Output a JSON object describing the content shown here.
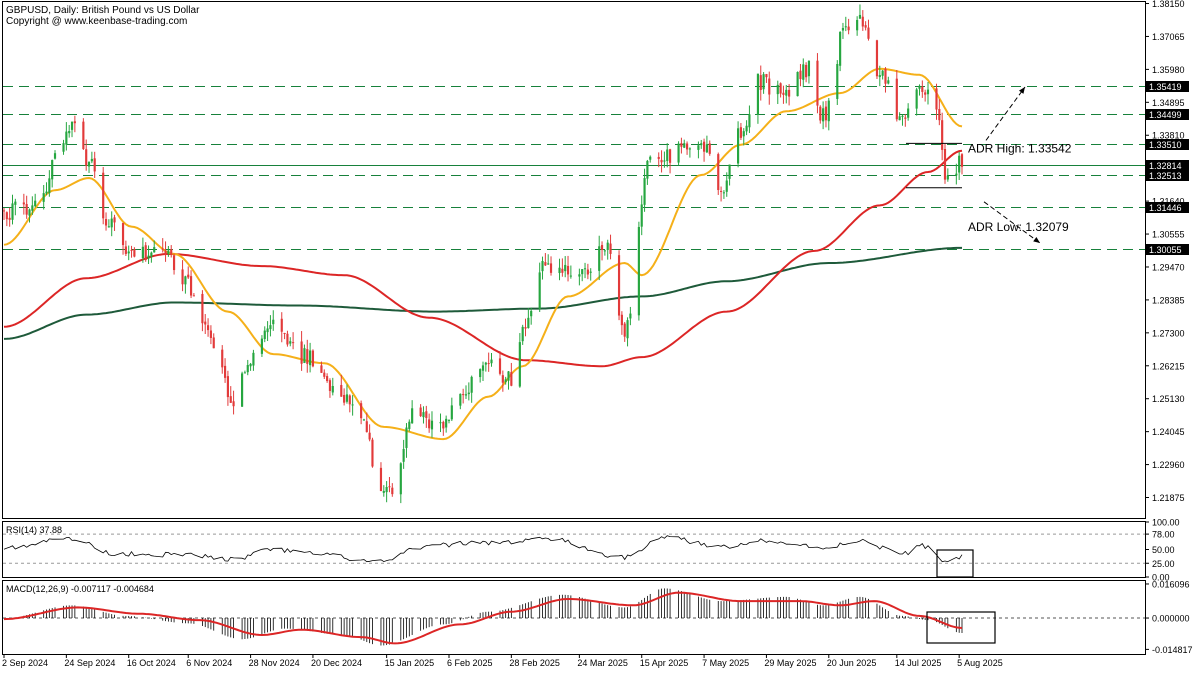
{
  "header": {
    "title": "GBPUSD, Daily:  British Pound vs US Dollar",
    "copyright": "Copyright @ www.keenbase-trading.com"
  },
  "colors": {
    "bull": "#26a640",
    "bear": "#e23a3a",
    "ma_fast": "#f5b019",
    "ma_mid": "#dc2626",
    "ma_slow": "#1e5a3a",
    "level_line": "#17813b",
    "annotation": "#000000"
  },
  "chart_data": [
    {
      "type": "candlestick",
      "panel": "main",
      "title": "GBPUSD, Daily:  British Pound vs US Dollar",
      "ylim": [
        1.212,
        1.382
      ],
      "y_ticks": [
        "1.38150",
        "1.37065",
        "1.35980",
        "1.34895",
        "1.33810",
        "1.31640",
        "1.30555",
        "1.29470",
        "1.28385",
        "1.27300",
        "1.26215",
        "1.25130",
        "1.24045",
        "1.22960",
        "1.21875"
      ],
      "x_ticks": [
        "2 Sep 2024",
        "24 Sep 2024",
        "16 Oct 2024",
        "6 Nov 2024",
        "28 Nov 2024",
        "20 Dec 2024",
        "15 Jan 2025",
        "6 Feb 2025",
        "28 Feb 2025",
        "24 Mar 2025",
        "15 Apr 2025",
        "7 May 2025",
        "29 May 2025",
        "20 Jun 2025",
        "14 Jul 2025",
        "5 Aug 2025"
      ],
      "close_anchors": [
        [
          "2024-09-02",
          1.313
        ],
        [
          "2024-09-12",
          1.314
        ],
        [
          "2024-09-26",
          1.34
        ],
        [
          "2024-10-02",
          1.329
        ],
        [
          "2024-10-08",
          1.309
        ],
        [
          "2024-10-17",
          1.3
        ],
        [
          "2024-10-30",
          1.298
        ],
        [
          "2024-11-06",
          1.289
        ],
        [
          "2024-11-12",
          1.276
        ],
        [
          "2024-11-22",
          1.251
        ],
        [
          "2024-11-28",
          1.264
        ],
        [
          "2024-12-06",
          1.276
        ],
        [
          "2024-12-18",
          1.265
        ],
        [
          "2024-12-31",
          1.252
        ],
        [
          "2025-01-06",
          1.246
        ],
        [
          "2025-01-13",
          1.219
        ],
        [
          "2025-01-17",
          1.22
        ],
        [
          "2025-01-24",
          1.248
        ],
        [
          "2025-02-03",
          1.242
        ],
        [
          "2025-02-14",
          1.256
        ],
        [
          "2025-02-20",
          1.262
        ],
        [
          "2025-02-28",
          1.258
        ],
        [
          "2025-03-04",
          1.275
        ],
        [
          "2025-03-12",
          1.295
        ],
        [
          "2025-03-26",
          1.293
        ],
        [
          "2025-04-02",
          1.302
        ],
        [
          "2025-04-09",
          1.274
        ],
        [
          "2025-04-18",
          1.329
        ],
        [
          "2025-04-25",
          1.332
        ],
        [
          "2025-05-06",
          1.336
        ],
        [
          "2025-05-13",
          1.321
        ],
        [
          "2025-05-20",
          1.339
        ],
        [
          "2025-05-26",
          1.356
        ],
        [
          "2025-06-04",
          1.352
        ],
        [
          "2025-06-13",
          1.36
        ],
        [
          "2025-06-18",
          1.344
        ],
        [
          "2025-06-26",
          1.374
        ],
        [
          "2025-07-01",
          1.376
        ],
        [
          "2025-07-08",
          1.359
        ],
        [
          "2025-07-16",
          1.343
        ],
        [
          "2025-07-23",
          1.355
        ],
        [
          "2025-07-28",
          1.344
        ],
        [
          "2025-08-01",
          1.323
        ],
        [
          "2025-08-05",
          1.329
        ]
      ],
      "levels": [
        "1.35419",
        "1.34499",
        "1.33510",
        "1.32513",
        "1.31446",
        "1.30055"
      ],
      "current_price": "1.32814",
      "annotations": {
        "adr_high": "ADR High: 1.33542",
        "adr_low": "ADR Low: 1.32079"
      },
      "ma_fast_anchors": [
        [
          "2024-09-02",
          1.302
        ],
        [
          "2024-09-20",
          1.32
        ],
        [
          "2024-10-02",
          1.324
        ],
        [
          "2024-10-17",
          1.308
        ],
        [
          "2024-11-01",
          1.299
        ],
        [
          "2024-11-20",
          1.28
        ],
        [
          "2024-12-06",
          1.266
        ],
        [
          "2024-12-24",
          1.263
        ],
        [
          "2025-01-14",
          1.242
        ],
        [
          "2025-02-04",
          1.238
        ],
        [
          "2025-02-20",
          1.252
        ],
        [
          "2025-03-04",
          1.262
        ],
        [
          "2025-03-20",
          1.285
        ],
        [
          "2025-04-09",
          1.296
        ],
        [
          "2025-04-15",
          1.292
        ],
        [
          "2025-05-06",
          1.325
        ],
        [
          "2025-05-20",
          1.335
        ],
        [
          "2025-06-05",
          1.346
        ],
        [
          "2025-06-24",
          1.352
        ],
        [
          "2025-07-08",
          1.36
        ],
        [
          "2025-07-22",
          1.358
        ],
        [
          "2025-08-06",
          1.341
        ]
      ],
      "ma_mid_anchors": [
        [
          "2024-09-02",
          1.275
        ],
        [
          "2024-10-01",
          1.291
        ],
        [
          "2024-10-30",
          1.299
        ],
        [
          "2024-12-02",
          1.295
        ],
        [
          "2024-12-31",
          1.292
        ],
        [
          "2025-01-30",
          1.278
        ],
        [
          "2025-03-05",
          1.264
        ],
        [
          "2025-04-01",
          1.262
        ],
        [
          "2025-04-15",
          1.265
        ],
        [
          "2025-05-15",
          1.28
        ],
        [
          "2025-06-15",
          1.3
        ],
        [
          "2025-07-08",
          1.315
        ],
        [
          "2025-07-25",
          1.326
        ],
        [
          "2025-08-06",
          1.333
        ]
      ],
      "ma_slow_anchors": [
        [
          "2024-09-02",
          1.271
        ],
        [
          "2024-10-01",
          1.279
        ],
        [
          "2024-11-01",
          1.283
        ],
        [
          "2024-12-15",
          1.282
        ],
        [
          "2025-02-01",
          1.28
        ],
        [
          "2025-03-10",
          1.281
        ],
        [
          "2025-04-15",
          1.285
        ],
        [
          "2025-05-15",
          1.29
        ],
        [
          "2025-06-20",
          1.296
        ],
        [
          "2025-08-06",
          1.301
        ]
      ]
    },
    {
      "type": "line",
      "panel": "rsi",
      "title": "RSI(14) 37.88",
      "ylim": [
        0,
        100
      ],
      "y_ticks": [
        "100.00",
        "78.00",
        "50.00",
        "25.00",
        "0.00"
      ],
      "series": [
        {
          "name": "RSI(14)",
          "anchors": [
            [
              "2024-09-02",
              54
            ],
            [
              "2024-09-26",
              70
            ],
            [
              "2024-10-10",
              43
            ],
            [
              "2024-11-06",
              40
            ],
            [
              "2024-11-22",
              32
            ],
            [
              "2024-12-06",
              50
            ],
            [
              "2024-12-20",
              42
            ],
            [
              "2025-01-13",
              27
            ],
            [
              "2025-01-28",
              55
            ],
            [
              "2025-02-14",
              62
            ],
            [
              "2025-02-28",
              64
            ],
            [
              "2025-03-12",
              70
            ],
            [
              "2025-04-09",
              35
            ],
            [
              "2025-04-22",
              73
            ],
            [
              "2025-05-13",
              55
            ],
            [
              "2025-05-26",
              66
            ],
            [
              "2025-06-18",
              54
            ],
            [
              "2025-07-01",
              66
            ],
            [
              "2025-07-16",
              42
            ],
            [
              "2025-07-23",
              57
            ],
            [
              "2025-08-01",
              27
            ],
            [
              "2025-08-06",
              38
            ]
          ]
        }
      ]
    },
    {
      "type": "bar+line",
      "panel": "macd",
      "title": "MACD(12,26,9) -0.007117 -0.004684",
      "ylim": [
        -0.017,
        0.0175
      ],
      "y_ticks": [
        "0.016096",
        "0.000000",
        "-0.014817"
      ],
      "series": [
        {
          "name": "MACD",
          "anchors": [
            [
              "2024-09-02",
              -0.0002
            ],
            [
              "2024-09-26",
              0.006
            ],
            [
              "2024-10-15",
              0.001
            ],
            [
              "2024-11-06",
              -0.0025
            ],
            [
              "2024-11-25",
              -0.01
            ],
            [
              "2024-12-10",
              -0.005
            ],
            [
              "2024-12-31",
              -0.008
            ],
            [
              "2025-01-13",
              -0.013
            ],
            [
              "2025-02-04",
              -0.003
            ],
            [
              "2025-02-20",
              0.003
            ],
            [
              "2025-03-18",
              0.011
            ],
            [
              "2025-04-09",
              0.005
            ],
            [
              "2025-04-23",
              0.014
            ],
            [
              "2025-05-13",
              0.008
            ],
            [
              "2025-06-05",
              0.01
            ],
            [
              "2025-06-18",
              0.006
            ],
            [
              "2025-07-01",
              0.01
            ],
            [
              "2025-07-16",
              0.001
            ],
            [
              "2025-07-25",
              -0.001
            ],
            [
              "2025-08-06",
              -0.0071
            ]
          ]
        },
        {
          "name": "Signal",
          "anchors": [
            [
              "2024-09-02",
              -0.0005
            ],
            [
              "2024-09-28",
              0.005
            ],
            [
              "2024-10-20",
              0.002
            ],
            [
              "2024-11-10",
              -0.001
            ],
            [
              "2024-12-02",
              -0.008
            ],
            [
              "2024-12-16",
              -0.0055
            ],
            [
              "2025-01-06",
              -0.009
            ],
            [
              "2025-01-18",
              -0.012
            ],
            [
              "2025-02-10",
              -0.003
            ],
            [
              "2025-02-28",
              0.003
            ],
            [
              "2025-03-20",
              0.009
            ],
            [
              "2025-04-12",
              0.006
            ],
            [
              "2025-04-28",
              0.012
            ],
            [
              "2025-05-20",
              0.008
            ],
            [
              "2025-06-10",
              0.008
            ],
            [
              "2025-06-24",
              0.006
            ],
            [
              "2025-07-06",
              0.008
            ],
            [
              "2025-07-22",
              0.001
            ],
            [
              "2025-08-06",
              -0.0047
            ]
          ]
        }
      ]
    }
  ]
}
